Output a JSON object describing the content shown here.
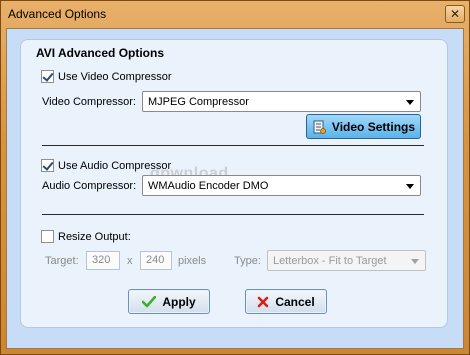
{
  "window": {
    "title": "Advanced Options",
    "close_glyph": "✕"
  },
  "heading": "AVI Advanced Options",
  "video": {
    "checkbox_label": "Use Video Compressor",
    "checked": true,
    "compressor_label": "Video Compressor:",
    "compressor_value": "MJPEG Compressor",
    "settings_button": "Video Settings"
  },
  "audio": {
    "checkbox_label": "Use Audio Compressor",
    "checked": true,
    "compressor_label": "Audio Compressor:",
    "compressor_value": "WMAudio Encoder DMO"
  },
  "resize": {
    "checkbox_label": "Resize Output:",
    "checked": false,
    "target_label": "Target:",
    "width_value": "320",
    "x_label": "x",
    "height_value": "240",
    "unit_label": "pixels",
    "type_label": "Type:",
    "type_value": "Letterbox - Fit to Target"
  },
  "buttons": {
    "apply": "Apply",
    "cancel": "Cancel"
  },
  "watermark": "dpwnload"
}
